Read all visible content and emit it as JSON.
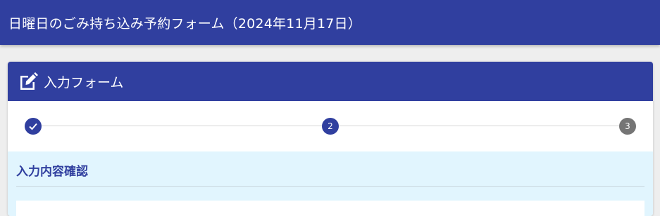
{
  "app": {
    "title": "日曜日のごみ持ち込み予約フォーム（2024年11月17日）"
  },
  "card": {
    "header_title": "入力フォーム",
    "header_icon": "edit-icon"
  },
  "stepper": {
    "steps": [
      {
        "label": "",
        "state": "completed",
        "icon": "check-icon"
      },
      {
        "label": "2",
        "state": "active"
      },
      {
        "label": "3",
        "state": "pending"
      }
    ]
  },
  "section": {
    "title": "入力内容確認"
  },
  "colors": {
    "primary": "#303f9f",
    "pending": "#757575",
    "section_bg": "#e1f5fe"
  }
}
